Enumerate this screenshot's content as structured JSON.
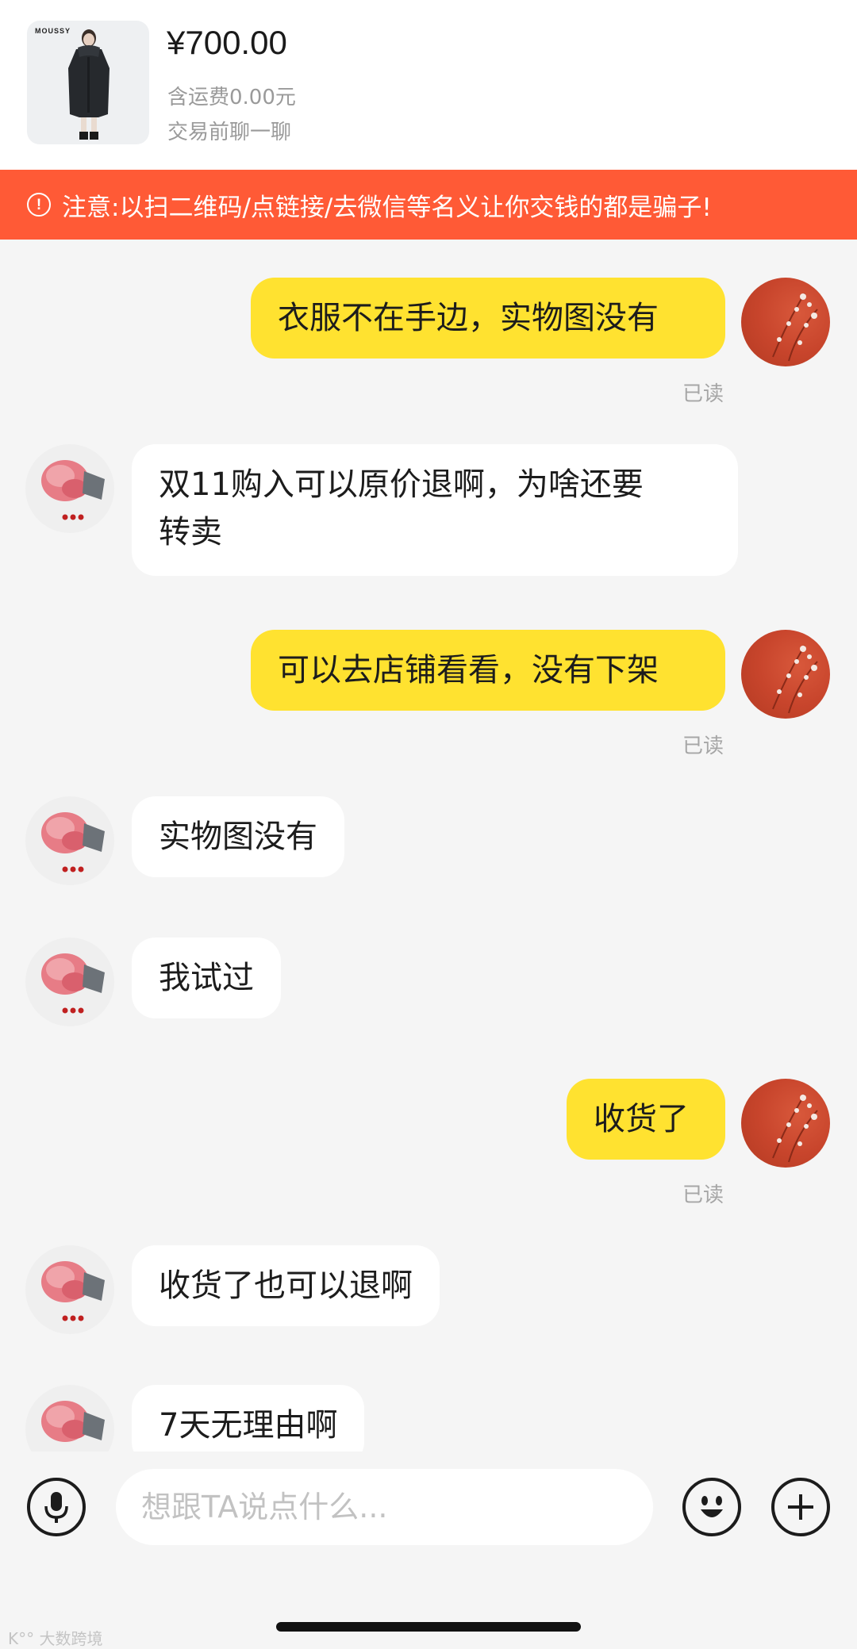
{
  "product": {
    "brand_text": "MOUSSY",
    "price": "¥700.00",
    "shipping": "含运费0.00元",
    "chat_hint": "交易前聊一聊"
  },
  "warning": {
    "icon": "exclamation-circle-icon",
    "text": "注意:以扫二维码/点链接/去微信等名义让你交钱的都是骗子!"
  },
  "messages": [
    {
      "sender": "self",
      "lines": [
        "衣服不在手边，实物图没有"
      ],
      "status": "已读"
    },
    {
      "sender": "other",
      "lines": [
        "双11购入可以原价退啊，为啥还要",
        "转卖"
      ]
    },
    {
      "sender": "self",
      "lines": [
        "可以去店铺看看，没有下架"
      ],
      "status": "已读"
    },
    {
      "sender": "other",
      "lines": [
        "实物图没有"
      ]
    },
    {
      "sender": "other",
      "lines": [
        "我试过"
      ]
    },
    {
      "sender": "self",
      "lines": [
        "收货了"
      ],
      "status": "已读"
    },
    {
      "sender": "other",
      "lines": [
        "收货了也可以退啊"
      ]
    },
    {
      "sender": "other",
      "lines": [
        "7天无理由啊"
      ]
    }
  ],
  "input_bar": {
    "voice_icon": "microphone-icon",
    "placeholder": "想跟TA说点什么...",
    "emoji_icon": "smiley-face-icon",
    "plus_icon": "plus-icon"
  },
  "watermark": "K°° 大数跨境",
  "colors": {
    "warning_bg": "#ff5a36",
    "self_bubble": "#ffe230",
    "other_bubble": "#ffffff",
    "chat_bg": "#f5f5f5"
  }
}
